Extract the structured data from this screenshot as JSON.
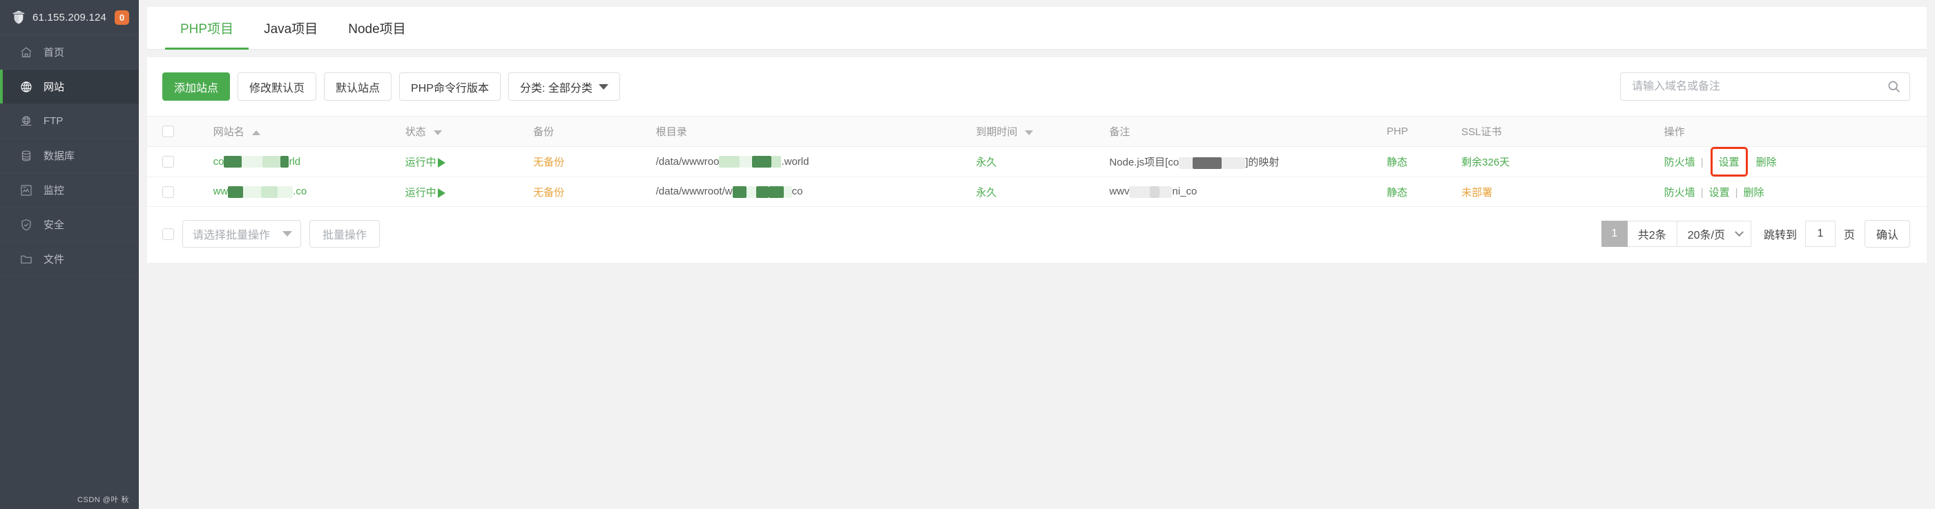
{
  "colors": {
    "accent_green": "#4aab4e",
    "sidebar_bg": "#3c434c",
    "sidebar_active_bg": "#343a41",
    "badge_orange": "#e8743a",
    "warn_orange": "#e8a33d",
    "highlight_red": "#f03a17"
  },
  "sidebar": {
    "logo_icon": "shield-pagoda-icon",
    "ip": "61.155.209.124",
    "badge": "0",
    "items": [
      {
        "label": "首页",
        "icon": "home-icon",
        "active": false
      },
      {
        "label": "网站",
        "icon": "globe-icon",
        "active": true
      },
      {
        "label": "FTP",
        "icon": "ftp-globe-icon",
        "active": false
      },
      {
        "label": "数据库",
        "icon": "database-icon",
        "active": false
      },
      {
        "label": "监控",
        "icon": "monitor-chart-icon",
        "active": false
      },
      {
        "label": "安全",
        "icon": "shield-check-icon",
        "active": false
      },
      {
        "label": "文件",
        "icon": "folder-icon",
        "active": false
      }
    ]
  },
  "tabs": [
    {
      "label": "PHP项目",
      "active": true
    },
    {
      "label": "Java项目",
      "active": false
    },
    {
      "label": "Node项目",
      "active": false
    }
  ],
  "toolbar": {
    "add_site": "添加站点",
    "modify_default_page": "修改默认页",
    "default_site": "默认站点",
    "php_cli_version": "PHP命令行版本",
    "category": "分类: 全部分类"
  },
  "search": {
    "placeholder": "请输入域名或备注",
    "value": "",
    "icon": "search-icon"
  },
  "table": {
    "headers": [
      {
        "label": "网站名",
        "sort": "asc"
      },
      {
        "label": "状态",
        "sort": "desc"
      },
      {
        "label": "备份",
        "sort": "none"
      },
      {
        "label": "根目录",
        "sort": "none"
      },
      {
        "label": "到期时间",
        "sort": "desc"
      },
      {
        "label": "备注",
        "sort": "none"
      },
      {
        "label": "PHP",
        "sort": "none"
      },
      {
        "label": "SSL证书",
        "sort": "none"
      },
      {
        "label": "操作",
        "sort": "none"
      }
    ],
    "rows": [
      {
        "name_prefix": "co",
        "name_suffix": "rld",
        "status": "运行中",
        "backup": "无备份",
        "root_prefix": "/data/wwwroo",
        "root_suffix": ".world",
        "expire": "永久",
        "note_prefix": "Node.js项目[co",
        "note_suffix": "]的映射",
        "php": "静态",
        "ssl": "剩余326天",
        "ssl_state": "ok",
        "ops": [
          "防火墙",
          "设置",
          "删除"
        ],
        "highlight_op": "设置"
      },
      {
        "name_prefix": "ww",
        "name_suffix": ".co",
        "status": "运行中",
        "backup": "无备份",
        "root_prefix": "/data/wwwroot/w",
        "root_suffix": "co",
        "expire": "永久",
        "note_prefix": "wwv",
        "note_suffix": "ni_co",
        "php": "静态",
        "ssl": "未部署",
        "ssl_state": "warn",
        "ops": [
          "防火墙",
          "设置",
          "删除"
        ],
        "highlight_op": ""
      }
    ]
  },
  "footer": {
    "batch_select_placeholder": "请选择批量操作",
    "batch_button": "批量操作",
    "page_current": "1",
    "total_text": "共2条",
    "page_size": "20条/页",
    "jump_label": "跳转到",
    "jump_value": "1",
    "jump_unit": "页",
    "confirm": "确认"
  },
  "watermark": "CSDN @叶 秋"
}
